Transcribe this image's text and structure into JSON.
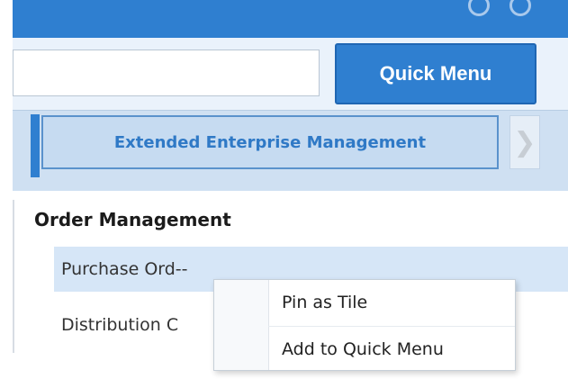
{
  "header": {
    "quick_menu_label": "Quick Menu",
    "search_value": ""
  },
  "tabs": {
    "active_label": "Extended Enterprise Management",
    "next_arrow": "❯"
  },
  "menu": {
    "section_title": "Order Management",
    "items": [
      {
        "label": "Purchase Ord‐‐"
      },
      {
        "label": "Distribution C"
      }
    ]
  },
  "context_menu": {
    "items": [
      {
        "label": "Pin as Tile"
      },
      {
        "label": "Add to Quick Menu"
      }
    ]
  }
}
